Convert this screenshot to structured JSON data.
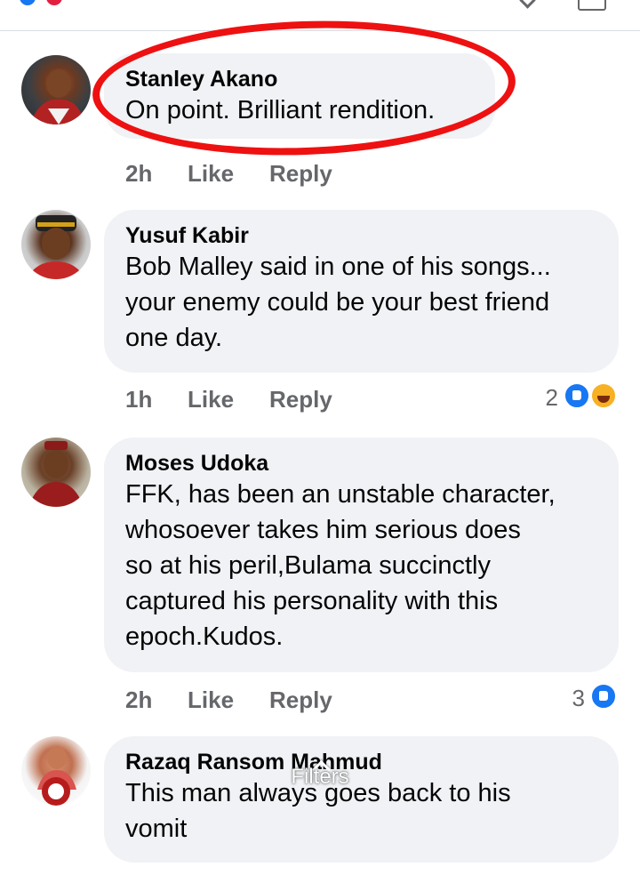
{
  "comments": [
    {
      "author": "Stanley Akano",
      "text_lines": [
        "On point. Brilliant rendition."
      ],
      "time": "2h",
      "like_label": "Like",
      "reply_label": "Reply"
    },
    {
      "author": "Yusuf Kabir",
      "text_lines": [
        "Bob Malley said in one of his songs...",
        "your enemy could be your best friend",
        "one day."
      ],
      "time": "1h",
      "like_label": "Like",
      "reply_label": "Reply",
      "reaction_count": "2",
      "reactions": [
        "like-icon",
        "haha-icon"
      ]
    },
    {
      "author": "Moses Udoka",
      "text_lines": [
        "FFK, has been an unstable character,",
        "whosoever takes him serious does",
        "so at his peril,Bulama succinctly",
        "captured his personality with this",
        "epoch.Kudos."
      ],
      "time": "2h",
      "like_label": "Like",
      "reply_label": "Reply",
      "reaction_count": "3",
      "reactions": [
        "like-icon"
      ]
    },
    {
      "author": "Razaq Ransom Mahmud",
      "text_lines": [
        "This man always goes back to his",
        "vomit"
      ]
    }
  ],
  "overlay": {
    "filters_label": "Filters"
  },
  "colors": {
    "bubble": "#f0f2f5",
    "meta_text": "#65676b",
    "highlight_ring": "#ee1111",
    "like_blue": "#1877f2"
  }
}
